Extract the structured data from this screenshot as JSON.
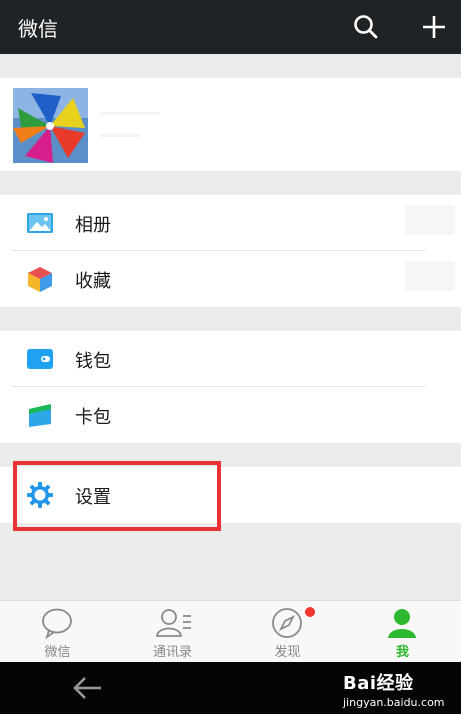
{
  "header": {
    "title": "微信",
    "search_icon": "search-icon",
    "add_icon": "plus-icon"
  },
  "profile": {
    "avatar": "pinwheel-avatar-image"
  },
  "menu": {
    "album": {
      "label": "相册",
      "icon": "album-icon"
    },
    "favorites": {
      "label": "收藏",
      "icon": "favorites-cube-icon"
    },
    "wallet": {
      "label": "钱包",
      "icon": "wallet-icon"
    },
    "cards": {
      "label": "卡包",
      "icon": "card-icon"
    },
    "settings": {
      "label": "设置",
      "icon": "gear-icon"
    }
  },
  "highlight_color": "#e83236",
  "tabs": [
    {
      "label": "微信",
      "icon": "chat-bubble-icon",
      "active": false
    },
    {
      "label": "通讯录",
      "icon": "contacts-icon",
      "active": false
    },
    {
      "label": "发现",
      "icon": "compass-icon",
      "active": false,
      "badge": "red-dot"
    },
    {
      "label": "我",
      "icon": "person-icon",
      "active": true
    }
  ],
  "active_color": "#2db830",
  "system_nav": {
    "back_icon": "back-arrow-icon"
  },
  "watermark": {
    "line1": "Bai经验",
    "line2": "jingyan.baidu.com"
  }
}
